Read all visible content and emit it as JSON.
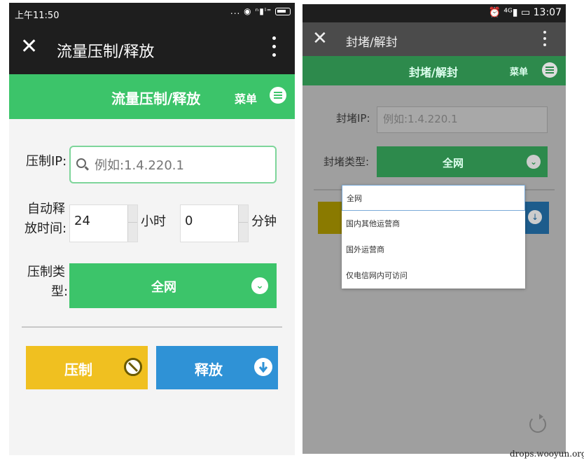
{
  "left_screen": {
    "status": {
      "time": "上午11:50",
      "icons": "... ◉ ⁿ▮ˡ⁼ "
    },
    "appbar": {
      "close": "✕",
      "title": "流量压制/释放"
    },
    "greenbar": {
      "title": "流量压制/释放",
      "menu_label": "菜单"
    },
    "form": {
      "ip_label": "压制IP:",
      "ip_placeholder": "例如:1.4.220.1",
      "release_label_1": "自动释",
      "release_label_2": "放时间:",
      "hours_value": "24",
      "hours_unit": "小时",
      "minutes_value": "0",
      "minutes_unit": "分钟",
      "type_label_1": "压制类",
      "type_label_2": "型:",
      "type_value": "全网"
    },
    "buttons": {
      "suppress": "压制",
      "release": "释放"
    },
    "colors": {
      "green": "#3cc46a",
      "yellow": "#f0c020",
      "blue": "#2f92d6",
      "dark": "#1e1e1e"
    }
  },
  "right_screen": {
    "status": {
      "icons": "⏰ ⁴ᴳ▮ ▭",
      "time": "13:07"
    },
    "appbar": {
      "close": "✕",
      "title": "封堵/解封"
    },
    "greenbar": {
      "title": "封堵/解封",
      "menu_label": "菜单"
    },
    "form": {
      "ip_label": "封堵IP:",
      "ip_placeholder": "例如:1.4.220.1",
      "type_label": "封堵类型:",
      "type_value": "全网"
    },
    "dropdown": {
      "options": [
        "全网",
        "国内其他运营商",
        "国外运营商",
        "仅电信网内可访问"
      ],
      "selected_index": 0
    }
  },
  "watermark": "drops.wooyun.org"
}
